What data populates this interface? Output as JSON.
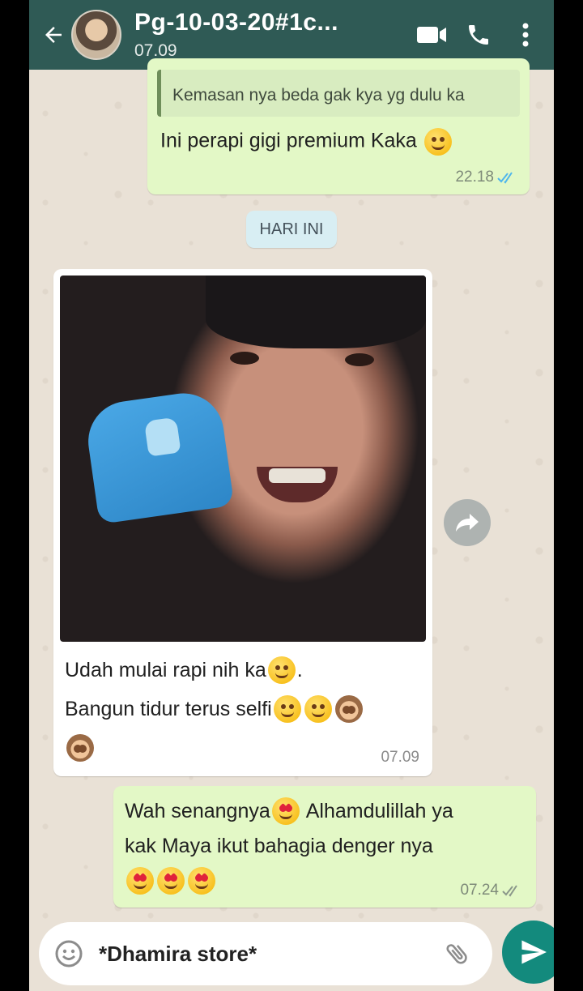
{
  "header": {
    "title": "Pg-10-03-20#1c...",
    "subtitle": "07.09",
    "icons": [
      "back-arrow-icon",
      "avatar",
      "video-call-icon",
      "phone-icon",
      "more-vert-icon"
    ]
  },
  "messages": [
    {
      "direction": "outgoing",
      "quote_text": "Kemasan nya beda gak kya yg dulu ka",
      "text": "Ini perapi gigi premium Kaka",
      "emoji": [
        "slightly-smiling-face"
      ],
      "time": "22.18",
      "status": "read"
    },
    {
      "direction": "incoming",
      "has_photo": true,
      "lines": [
        "Udah mulai rapi nih ka",
        "Bangun tidur terus selfi"
      ],
      "line1_suffix": ".",
      "emoji_line1": [
        "grinning-face"
      ],
      "emoji_line2": [
        "rolling-laughing",
        "rolling-laughing",
        "see-no-evil-monkey"
      ],
      "emoji_line3": [
        "see-no-evil-monkey"
      ],
      "time": "07.09"
    },
    {
      "direction": "outgoing",
      "line1_a": "Wah senangnya",
      "line1_b": "Alhamdulillah ya",
      "line2": "kak Maya ikut bahagia denger nya",
      "emoji_line3": [
        "heart-eyes",
        "heart-eyes",
        "smiling-face-with-hearts"
      ],
      "time": "07.24",
      "status": "delivered"
    }
  ],
  "day_divider": "HARI INI",
  "composer": {
    "value": "*Dhamira store*",
    "icons": [
      "emoji-icon",
      "attach-icon",
      "send-icon"
    ]
  },
  "colors": {
    "header": "#2f5a55",
    "outgoing_bubble": "#e3f8c6",
    "incoming_bubble": "#ffffff",
    "send_button": "#138a7d",
    "read_ticks": "#4fb6ec"
  }
}
